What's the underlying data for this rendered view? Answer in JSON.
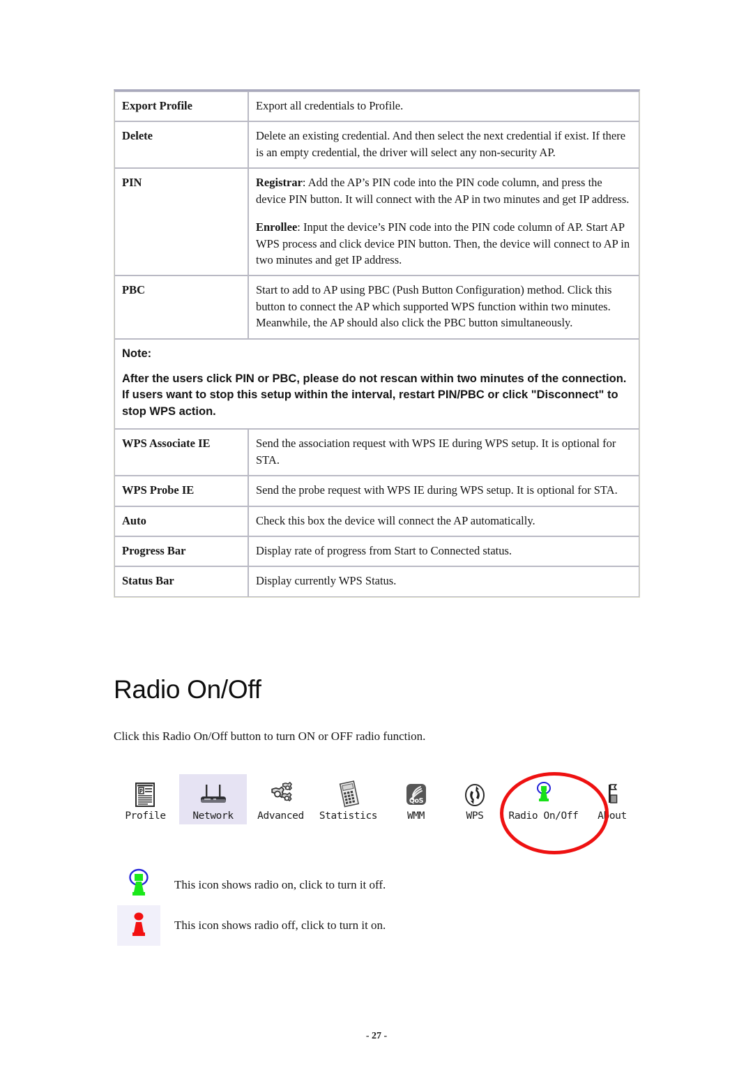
{
  "table": {
    "rows": [
      {
        "label": "Export Profile",
        "paragraphs": [
          {
            "text": "Export all credentials to Profile."
          }
        ]
      },
      {
        "label": "Delete",
        "paragraphs": [
          {
            "text": "Delete an existing credential. And then select the next credential if exist. If there is an empty credential, the driver will select any non-security AP."
          }
        ]
      },
      {
        "label": "PIN",
        "paragraphs": [
          {
            "lead": "Registrar",
            "text": ": Add the AP’s PIN code into the PIN code column, and press the device PIN button. It will connect with the AP in two minutes and get IP address."
          },
          {
            "lead": "Enrollee",
            "text": ": Input the device’s PIN code into the PIN code column of AP. Start AP WPS process and click device PIN button. Then, the device will connect to AP in two minutes and get IP address."
          }
        ]
      },
      {
        "label": "PBC",
        "paragraphs": [
          {
            "text": "Start to add to AP using PBC (Push Button Configuration) method. Click this button to connect the AP which supported WPS function within two minutes. Meanwhile, the AP should also click the PBC button simultaneously."
          }
        ]
      }
    ],
    "note": {
      "title": "Note:",
      "body": "After the users click PIN or PBC, please do not rescan within two minutes of the connection. If users want to stop this setup within the interval, restart PIN/PBC or click \"Disconnect\" to stop WPS action.",
      "color": "#8e2a8b"
    },
    "rows_after_note": [
      {
        "label": "WPS Associate IE",
        "paragraphs": [
          {
            "text": "Send the association request with WPS IE during WPS setup. It is optional for STA."
          }
        ]
      },
      {
        "label": "WPS Probe IE",
        "paragraphs": [
          {
            "text": "Send the probe request with WPS IE during WPS setup. It is optional for STA."
          }
        ]
      },
      {
        "label": "Auto",
        "paragraphs": [
          {
            "text": "Check this box the device will connect the AP automatically."
          }
        ]
      },
      {
        "label": "Progress Bar",
        "paragraphs": [
          {
            "text": "Display rate of progress from Start to Connected status."
          }
        ]
      },
      {
        "label": "Status Bar",
        "paragraphs": [
          {
            "text": "Display currently WPS Status."
          }
        ]
      }
    ]
  },
  "section": {
    "heading": "Radio On/Off",
    "intro": "Click this Radio On/Off button to turn ON or OFF radio function."
  },
  "toolbar": {
    "items": [
      {
        "label": "Profile",
        "icon": "profile-document-icon",
        "selected": false
      },
      {
        "label": "Network",
        "icon": "router-icon",
        "selected": true
      },
      {
        "label": "Advanced",
        "icon": "gears-icon",
        "selected": false
      },
      {
        "label": "Statistics",
        "icon": "calculator-icon",
        "selected": false
      },
      {
        "label": "WMM",
        "icon": "qos-icon",
        "selected": false
      },
      {
        "label": "WPS",
        "icon": "wps-arrows-icon",
        "selected": false
      },
      {
        "label": "Radio On/Off",
        "icon": "radio-tower-on-icon",
        "selected": false
      },
      {
        "label": "About",
        "icon": "about-flag-icon",
        "selected": false
      }
    ],
    "annotation": {
      "shape": "ellipse",
      "color": "#ee1111",
      "target": "Radio On/Off"
    }
  },
  "legend": {
    "rows": [
      {
        "icon": "radio-tower-on-icon",
        "text": "This icon shows radio on, click to turn it off.",
        "color": "#1ae81a"
      },
      {
        "icon": "radio-tower-off-icon",
        "text": "This icon shows radio off, click to turn it on.",
        "color": "#f21010"
      }
    ]
  },
  "footer": {
    "page_number": "- 27 -"
  }
}
